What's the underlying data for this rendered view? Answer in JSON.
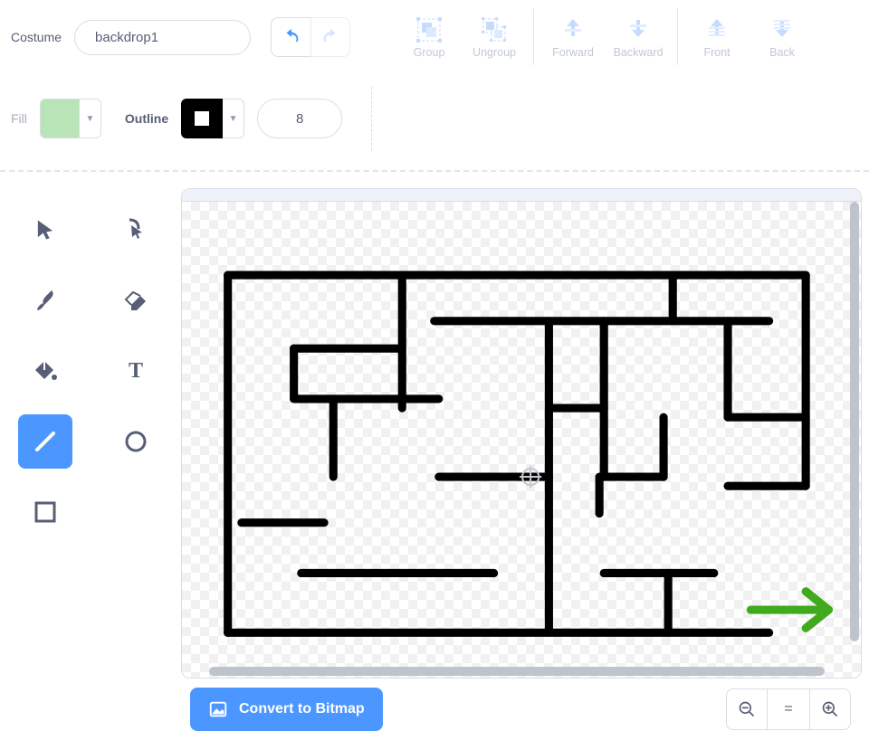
{
  "header": {
    "costume_label": "Costume",
    "costume_name": "backdrop1",
    "actions": {
      "group": "Group",
      "ungroup": "Ungroup",
      "forward": "Forward",
      "backward": "Backward",
      "front": "Front",
      "back": "Back"
    }
  },
  "style_row": {
    "fill_label": "Fill",
    "fill_color": "#b8e4b8",
    "outline_label": "Outline",
    "outline_color": "#000000",
    "outline_inner": "#ffffff",
    "stroke_width": "8"
  },
  "tools": {
    "select": "select",
    "reshape": "reshape",
    "brush": "brush",
    "eraser": "eraser",
    "fill": "fill",
    "text": "text",
    "line": "line",
    "circle": "circle",
    "rect": "rect",
    "active": "line"
  },
  "footer": {
    "convert_label": "Convert to Bitmap",
    "zoom_out": "−",
    "zoom_reset": "=",
    "zoom_in": "+"
  },
  "colors": {
    "accent": "#4c97ff",
    "icon_gray": "#575e75",
    "light_blue": "#87b4ff",
    "arrow_green": "#4caf22"
  }
}
